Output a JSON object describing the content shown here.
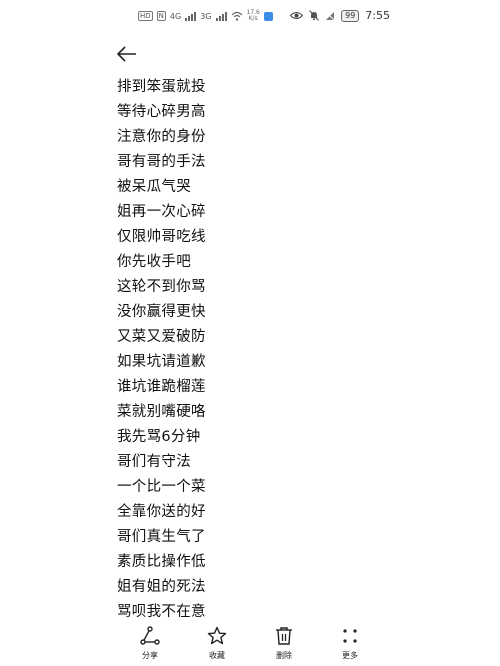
{
  "status_bar": {
    "signal_labels": [
      "4G",
      "3G"
    ],
    "net_speed_value": "17.6",
    "net_speed_unit": "K/s",
    "battery": "99",
    "time": "7:55"
  },
  "lines": [
    "排到笨蛋就投",
    "等待心碎男高",
    "注意你的身份",
    "哥有哥的手法",
    "被呆瓜气哭",
    "姐再一次心碎",
    "仅限帅哥吃线",
    "你先收手吧",
    "这轮不到你骂",
    "没你赢得更快",
    "又菜又爱破防",
    "如果坑请道歉",
    "谁坑谁跪榴莲",
    "菜就别嘴硬咯",
    "我先骂6分钟",
    "哥们有守法",
    "一个比一个菜",
    "全靠你送的好",
    "哥们真生气了",
    "素质比操作低",
    "姐有姐的死法",
    "骂呗我不在意"
  ],
  "toolbar": {
    "share": {
      "label": "分享",
      "icon": "share-icon"
    },
    "favorite": {
      "label": "收藏",
      "icon": "star-icon"
    },
    "delete": {
      "label": "删除",
      "icon": "trash-icon"
    },
    "more": {
      "label": "更多",
      "icon": "more-dots-icon"
    }
  }
}
